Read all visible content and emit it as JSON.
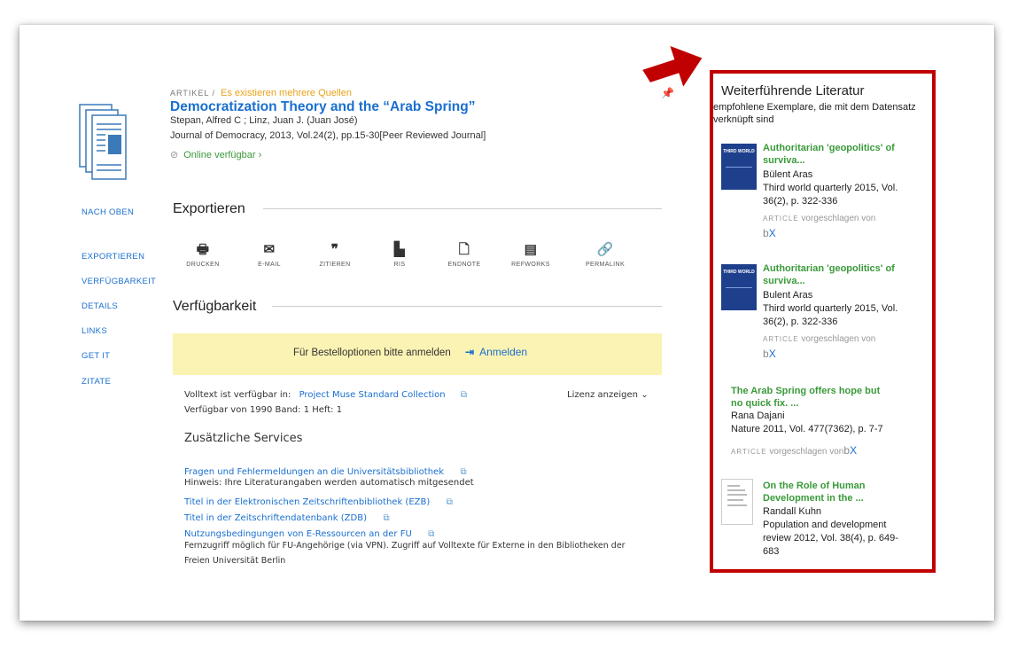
{
  "record": {
    "type_label": "ARTIKEL /",
    "sources_note": "Es existieren mehrere Quellen",
    "title": "Democratization Theory and the “Arab Spring”",
    "authors": "Stepan, Alfred C ; Linz, Juan J. (Juan José)",
    "journal": "Journal of Democracy, 2013, Vol.24(2), pp.15-30[Peer Reviewed Journal]",
    "online": "Online verfügbar ›"
  },
  "nav": {
    "back_top": "NACH OBEN",
    "items": [
      "EXPORTIEREN",
      "VERFÜGBARKEIT",
      "DETAILS",
      "LINKS",
      "GET IT",
      "ZITATE"
    ]
  },
  "export": {
    "heading": "Exportieren",
    "actions": [
      {
        "label": "DRUCKEN",
        "icon": "print-icon"
      },
      {
        "label": "E-MAIL",
        "icon": "mail-icon"
      },
      {
        "label": "ZITIEREN",
        "icon": "quote-icon"
      },
      {
        "label": "RIS",
        "icon": "file-icon"
      },
      {
        "label": "ENDNOTE",
        "icon": "endnote-icon"
      },
      {
        "label": "REFWORKS",
        "icon": "refworks-icon"
      },
      {
        "label": "PERMALINK",
        "icon": "link-icon"
      }
    ]
  },
  "availability": {
    "heading": "Verfügbarkeit",
    "login_text": "Für Bestelloptionen bitte anmelden",
    "login_button": "Anmelden",
    "fulltext_label": "Volltext ist verfügbar in:",
    "fulltext_collection": "Project Muse Standard Collection",
    "license": "Lizenz anzeigen",
    "available_from": "Verfügbar von 1990 Band: 1 Heft: 1",
    "services_heading": "Zusätzliche Services",
    "services": {
      "report": "Fragen und Fehlermeldungen an die Universitätsbibliothek",
      "report_note": "Hinweis: Ihre Literaturangaben werden automatisch mitgesendet",
      "ezb": "Titel in der Elektronischen Zeitschriftenbibliothek (EZB)",
      "zdb": "Titel in der Zeitschriftendatenbank (ZDB)",
      "terms": "Nutzungsbedingungen von E-Ressourcen an der FU",
      "access_note_1": "Fernzugriff möglich für FU-Angehörige (via VPN). Zugriff auf Volltexte für Externe in den Bibliotheken der",
      "access_note_2": "Freien Universität Berlin"
    }
  },
  "further": {
    "title": "Weiterführende Literatur",
    "subtitle": "empfohlene Exemplare, die mit dem Datensatz verknüpft sind",
    "suggested_by": "vorgeschlagen von",
    "article_label": "ARTICLE",
    "bx_b": "b",
    "bx_x": "X",
    "items": [
      {
        "title": "Authoritarian 'geopolitics' of surviva...",
        "author": "Bülent Aras",
        "source": "Third world quarterly 2015, Vol. 36(2), p. 322-336",
        "thumb_text": "THIRD WORLD"
      },
      {
        "title": "Authoritarian 'geopolitics' of surviva...",
        "author": "Bulent Aras",
        "source": "Third world quarterly 2015, Vol. 36(2), p. 322-336",
        "thumb_text": "THIRD WORLD"
      },
      {
        "title": "The Arab Spring offers hope but no quick fix. ...",
        "author": "Rana Dajani",
        "source": "Nature 2011, Vol. 477(7362), p. 7-7"
      },
      {
        "title": "On the Role of Human Development in the ...",
        "author": "Randall Kuhn",
        "source": "Population and development review 2012, Vol. 38(4), p. 649-683"
      }
    ]
  }
}
